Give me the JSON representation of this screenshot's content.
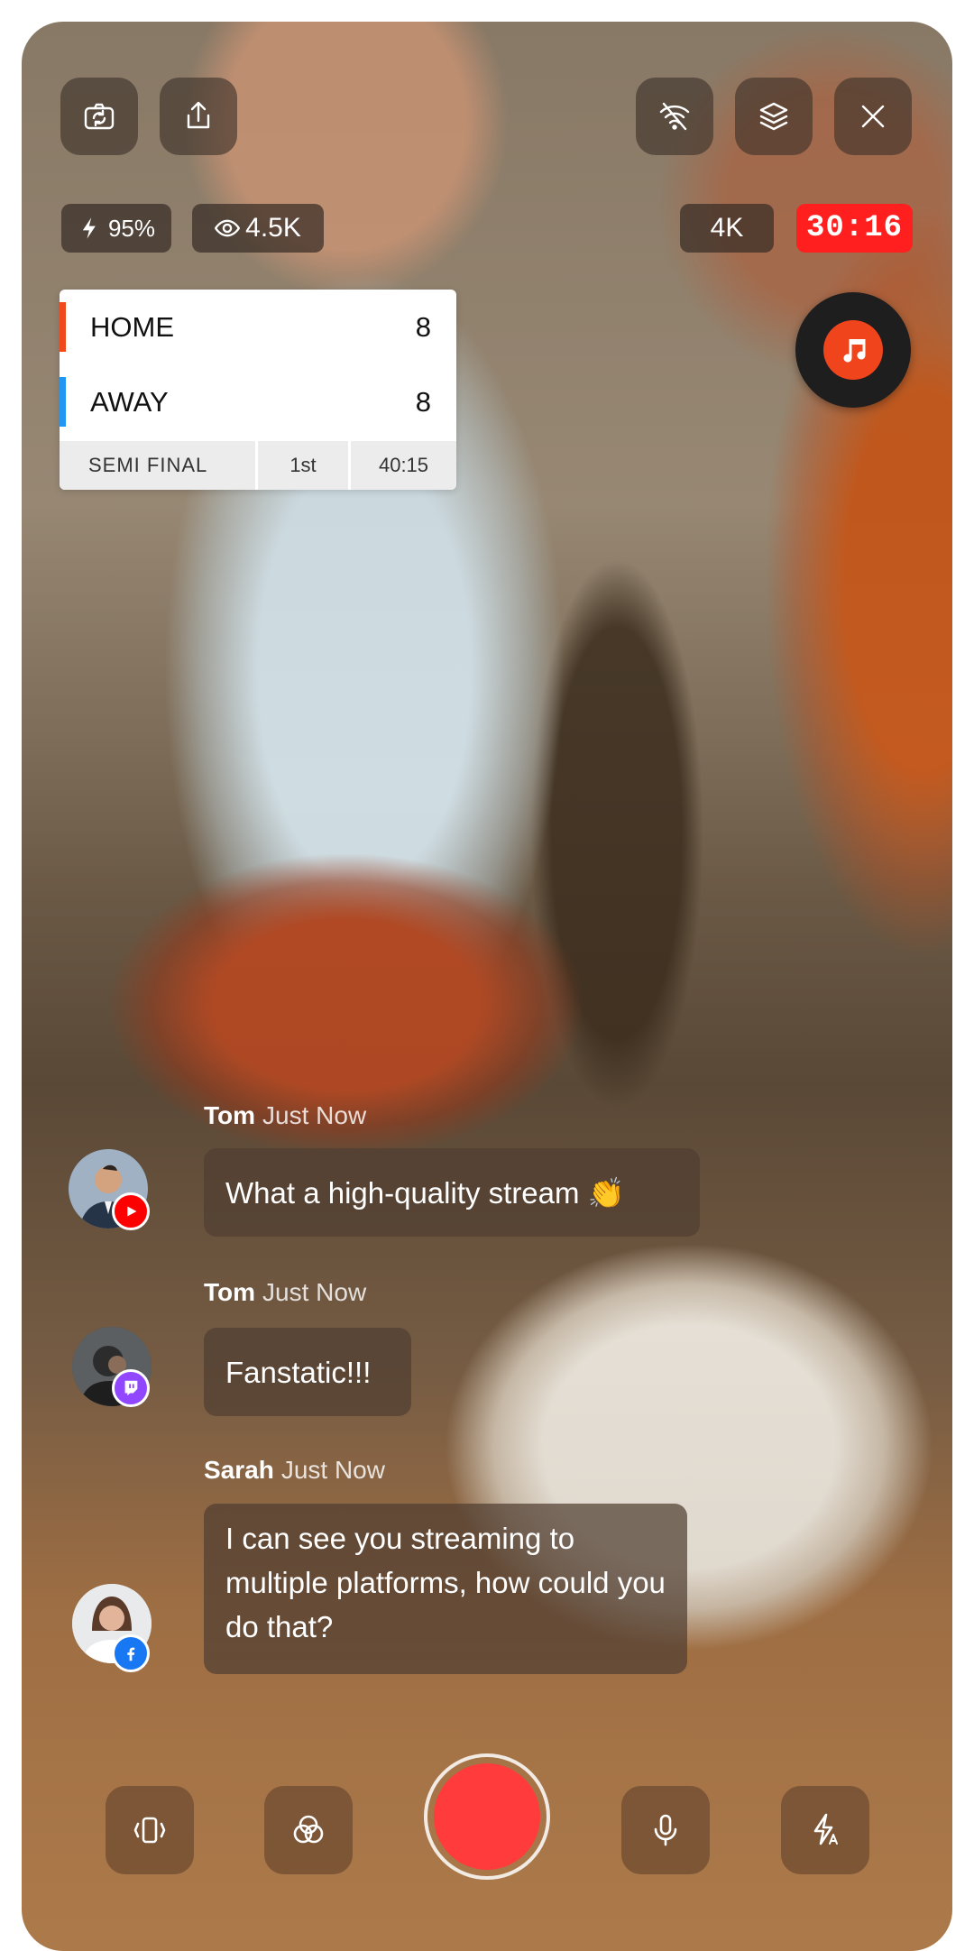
{
  "status": {
    "battery": "95%",
    "viewers": "4.5K",
    "quality": "4K",
    "timer": "30:16"
  },
  "scoreboard": {
    "home": {
      "name": "HOME",
      "score": "8",
      "color": "#f04a1c"
    },
    "away": {
      "name": "AWAY",
      "score": "8",
      "color": "#2196f3"
    },
    "stage": "SEMI FINAL",
    "period": "1st",
    "clock": "40:15"
  },
  "chat": [
    {
      "user": "Tom",
      "time": "Just Now",
      "message": "What a high-quality stream 👏",
      "platform": "youtube-icon"
    },
    {
      "user": "Tom",
      "time": "Just Now",
      "message": "Fanstatic!!!",
      "platform": "twitch-icon"
    },
    {
      "user": "Sarah",
      "time": "Just Now",
      "message": "I can see you streaming to multiple platforms, how could you do that?",
      "platform": "facebook-icon"
    }
  ],
  "icons": {
    "top_left": [
      "camera-switch-icon",
      "share-icon"
    ],
    "top_right": [
      "wifi-off-icon",
      "layers-icon",
      "close-icon"
    ],
    "bottom": [
      "vibrate-icon",
      "filters-icon",
      "record-button",
      "microphone-icon",
      "auto-flash-icon"
    ],
    "music": "music-note-icon"
  },
  "colors": {
    "record": "#ff3b3b",
    "timer_bg": "#ff1f1f",
    "music_accent": "#f0441c"
  }
}
